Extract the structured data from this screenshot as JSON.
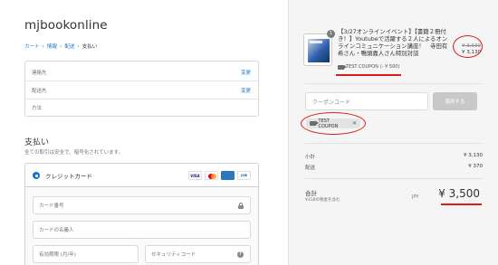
{
  "store": {
    "name": "mjbookonline"
  },
  "breadcrumb": [
    {
      "label": "カート"
    },
    {
      "label": "情報"
    },
    {
      "label": "配送"
    },
    {
      "label": "支払い"
    }
  ],
  "breadcrumb_sep": "›",
  "info": {
    "contact_label": "連絡先",
    "contact_change": "変更",
    "ship_label": "配送先",
    "ship_change": "変更",
    "method_label": "方法"
  },
  "payment": {
    "title": "支払い",
    "subtitle": "全ての取引は安全で、暗号化されています。",
    "credit_label": "クレジットカード",
    "logos": {
      "visa": "VISA",
      "amex": "AMERICAN EXPRESS",
      "jcb": "JCB"
    },
    "card_number_placeholder": "カード番号",
    "card_name_placeholder": "カードの名義人",
    "expiry_placeholder": "有効期限 (月/年)",
    "cvc_placeholder": "セキュリティコード",
    "help_mark": "?"
  },
  "order": {
    "quantity": "1",
    "product_title": "【3/27オンラインイベント】【書籍２冊付き！】Youtubeで活躍する２人によるオンラインコミュニケーション講座！　寺田有希さん・鴨頭嘉人さん特別対談",
    "price_old": "¥ 3,630",
    "price_new": "¥ 3,130",
    "discount_code": "TEST COUPON",
    "discount_amount": "(- ¥ 500)",
    "coupon_placeholder": "クーポンコード",
    "apply_button": "適用する",
    "applied_coupon": "TEST COUPON",
    "remove_mark": "✕"
  },
  "summary": {
    "subtotal_label": "小計",
    "subtotal_value": "¥ 3,130",
    "shipping_label": "配送",
    "shipping_value": "¥ 370",
    "total_label": "合計",
    "tax_note": "¥318の税金を含む",
    "currency": "JPY",
    "total_value": "¥ 3,500"
  },
  "colors": {
    "link": "#1a73c9",
    "annotation_red": "#d91c1c",
    "sidebar_bg": "#f5f5f5",
    "button_disabled": "#c8c8c8"
  },
  "icons": [
    "lock-icon",
    "help-icon",
    "tag-icon",
    "radio-selected-icon",
    "close-icon"
  ]
}
